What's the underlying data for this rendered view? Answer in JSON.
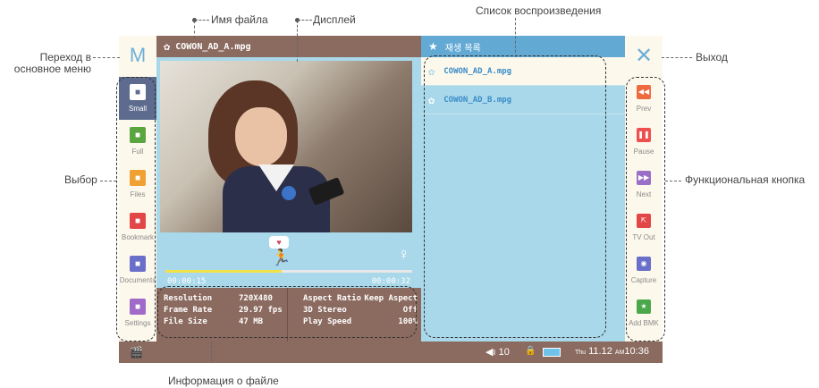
{
  "callouts": {
    "filename": "Имя файла",
    "display": "Дисплей",
    "playlist": "Список воспроизведения",
    "main_menu": "Переход в\nосновное меню",
    "exit": "Выход",
    "selection": "Выбор",
    "function_button": "Функциональная кнопка",
    "file_info": "Информация о файле"
  },
  "menu_button": "M",
  "exit_button": "✕",
  "title": {
    "filename": "COWON_AD_A.mpg",
    "icon": "film-reel-icon"
  },
  "left_menu": [
    {
      "label": "Small",
      "icon": "small-screen-icon",
      "color": "#5d6c8e",
      "active": true
    },
    {
      "label": "Full",
      "icon": "full-screen-icon",
      "color": "#5aa53f",
      "active": false
    },
    {
      "label": "Files",
      "icon": "folder-icon",
      "color": "#f0a133",
      "active": false
    },
    {
      "label": "Bookmark",
      "icon": "bookmark-icon",
      "color": "#e24646",
      "active": false
    },
    {
      "label": "Documents",
      "icon": "document-icon",
      "color": "#6a6fc9",
      "active": false
    },
    {
      "label": "Settings",
      "icon": "gear-icon",
      "color": "#a06ac9",
      "active": false
    }
  ],
  "player": {
    "current_time": "00:00:15",
    "total_time": "00:00:32",
    "progress": 0.47
  },
  "file_info": {
    "left": [
      {
        "key": "Resolution",
        "value": "720X480"
      },
      {
        "key": "Frame Rate",
        "value": "29.97 fps"
      },
      {
        "key": "File Size",
        "value": "47 MB"
      }
    ],
    "right": [
      {
        "key": "Aspect Ratio",
        "value": "Keep Aspect"
      },
      {
        "key": "3D Stereo",
        "value": "Off"
      },
      {
        "key": "Play Speed",
        "value": "100%"
      }
    ]
  },
  "playlist": {
    "title": "재생 목록",
    "items": [
      {
        "name": "COWON_AD_A.mpg",
        "selected": true
      },
      {
        "name": "COWON_AD_B.mpg",
        "selected": false
      }
    ]
  },
  "right_menu": [
    {
      "label": "Prev",
      "icon": "prev-icon",
      "glyph": "◀◀",
      "color": "#ee6b3f"
    },
    {
      "label": "Pause",
      "icon": "pause-icon",
      "glyph": "❚❚",
      "color": "#ee4f4f"
    },
    {
      "label": "Next",
      "icon": "next-icon",
      "glyph": "▶▶",
      "color": "#9a6fc8"
    },
    {
      "label": "TV Out",
      "icon": "tv-out-icon",
      "glyph": "⇱",
      "color": "#e24646"
    },
    {
      "label": "Capture",
      "icon": "camera-icon",
      "glyph": "◉",
      "color": "#6a6fc9"
    },
    {
      "label": "Add BMK",
      "icon": "add-bookmark-icon",
      "glyph": "★",
      "color": "#4aa84a"
    }
  ],
  "status": {
    "volume": "10",
    "weekday": "Thu",
    "date": "11.12",
    "ampm": "AM",
    "time": "10:36"
  }
}
